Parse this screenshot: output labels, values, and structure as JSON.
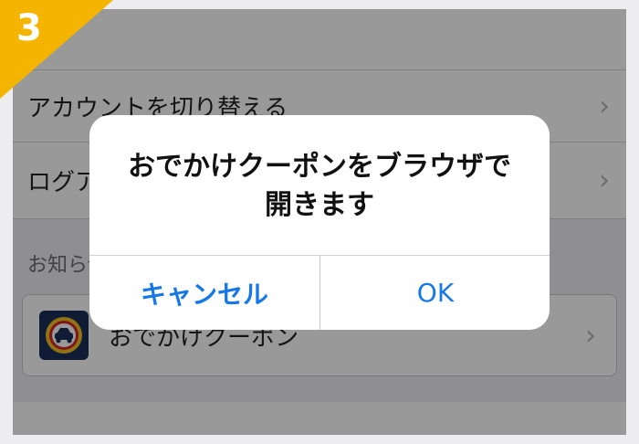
{
  "badge": {
    "number": "3",
    "color": "#f5b400"
  },
  "settings": {
    "rows": [
      {
        "label": "アカウントを切り替える",
        "chevron": "›"
      },
      {
        "label": "ログアウト",
        "chevron": "›"
      }
    ],
    "section_header": "お知らせ",
    "notice": {
      "label": "おでかけクーポン",
      "icon": "car-coupon-icon",
      "chevron": "›"
    }
  },
  "dialog": {
    "message_line1": "おでかけクーポンをブラウザで",
    "message_line2": "開きます",
    "cancel_label": "キャンセル",
    "ok_label": "OK",
    "accent_color": "#1677e6"
  }
}
